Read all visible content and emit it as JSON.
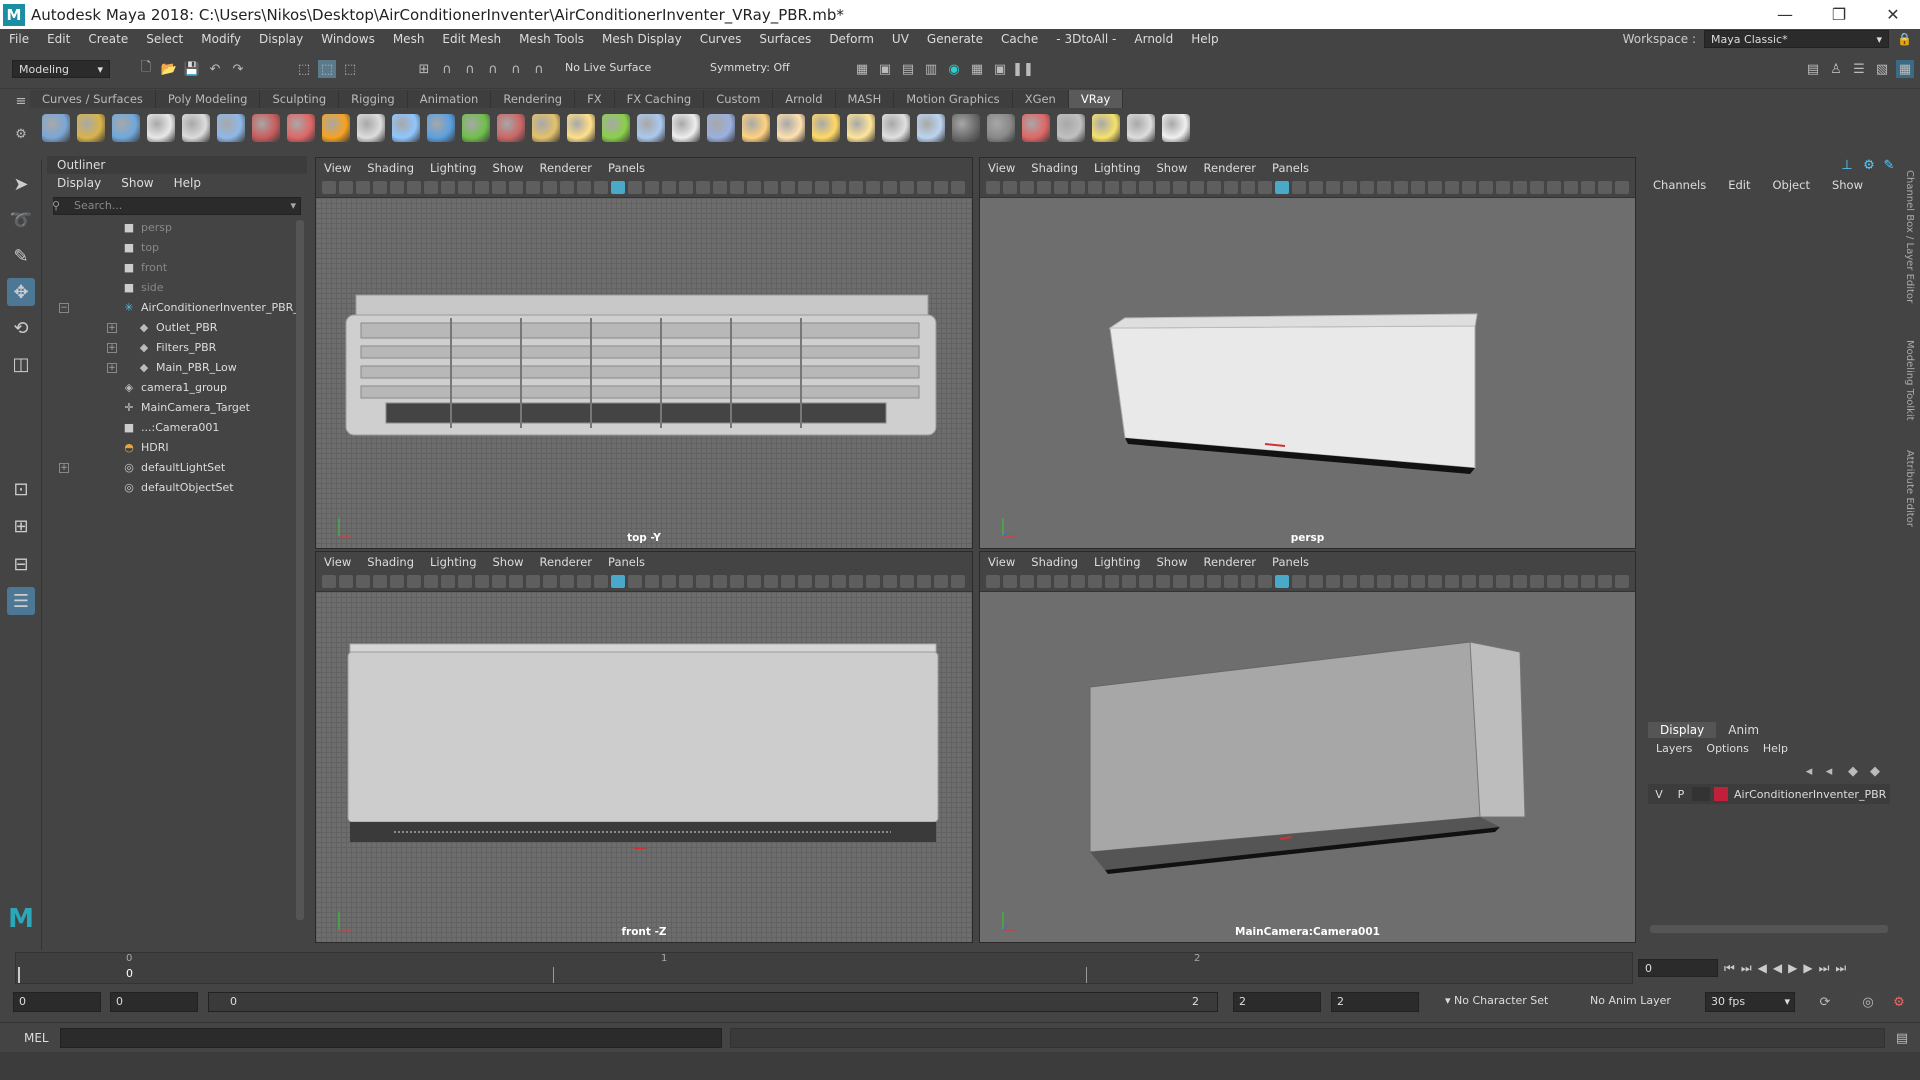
{
  "window": {
    "title": "Autodesk Maya 2018: C:\\Users\\Nikos\\Desktop\\AirConditionerInventer\\AirConditionerInventer_VRay_PBR.mb*",
    "minimize": "—",
    "maximize": "❐",
    "close": "✕"
  },
  "menubar": {
    "items": [
      "File",
      "Edit",
      "Create",
      "Select",
      "Modify",
      "Display",
      "Windows",
      "Mesh",
      "Edit Mesh",
      "Mesh Tools",
      "Mesh Display",
      "Curves",
      "Surfaces",
      "Deform",
      "UV",
      "Generate",
      "Cache",
      "- 3DtoAll -",
      "Arnold",
      "Help"
    ],
    "workspace_label": "Workspace :",
    "workspace_value": "Maya Classic*"
  },
  "statusline": {
    "mode": "Modeling",
    "live_surface": "No Live Surface",
    "symmetry": "Symmetry: Off"
  },
  "shelf": {
    "tabs": [
      "Curves / Surfaces",
      "Poly Modeling",
      "Sculpting",
      "Rigging",
      "Animation",
      "Rendering",
      "FX",
      "FX Caching",
      "Custom",
      "Arnold",
      "MASH",
      "Motion Graphics",
      "XGen",
      "VRay"
    ],
    "active_tab": "VRay",
    "icon_colors": [
      "#7aa7d6",
      "#d9b44a",
      "#6fa8dc",
      "#e8e8e8",
      "#dcdcdc",
      "#8fb8e8",
      "#c95c5c",
      "#e06666",
      "#f6a21f",
      "#dddddd",
      "#8ec6ff",
      "#5aa0e0",
      "#6fbf4a",
      "#c66",
      "#e3c26b",
      "#ffe08a",
      "#8ad04a",
      "#aac9ee",
      "#eee",
      "#9ab0e0",
      "#ffd27f",
      "#ffe0b0",
      "#ffd966",
      "#ffe599",
      "#e0e0e0",
      "#bcd4f0",
      "#6c6c6c",
      "#888",
      "#e06666",
      "#c0c0c0",
      "#f6e26b",
      "#dddddd",
      "#f0f0f0"
    ]
  },
  "outliner": {
    "title": "Outliner",
    "menu": [
      "Display",
      "Show",
      "Help"
    ],
    "search_placeholder": "Search...",
    "items": [
      {
        "label": "persp",
        "dim": true,
        "icon": "camera-icon"
      },
      {
        "label": "top",
        "dim": true,
        "icon": "camera-icon"
      },
      {
        "label": "front",
        "dim": true,
        "icon": "camera-icon"
      },
      {
        "label": "side",
        "dim": true,
        "icon": "camera-icon"
      },
      {
        "label": "AirConditionerInventer_PBR_",
        "dim": false,
        "icon": "group-icon",
        "expander": "−"
      },
      {
        "label": "Outlet_PBR",
        "dim": false,
        "icon": "mesh-icon",
        "expander": "+"
      },
      {
        "label": "Filters_PBR",
        "dim": false,
        "icon": "mesh-icon",
        "expander": "+"
      },
      {
        "label": "Main_PBR_Low",
        "dim": false,
        "icon": "mesh-icon",
        "expander": "+"
      },
      {
        "label": "camera1_group",
        "dim": false,
        "icon": "camera-group-icon"
      },
      {
        "label": "MainCamera_Target",
        "dim": false,
        "icon": "locator-icon"
      },
      {
        "label": "...:Camera001",
        "dim": false,
        "icon": "camera-icon"
      },
      {
        "label": "HDRI",
        "dim": false,
        "icon": "dome-light-icon"
      },
      {
        "label": "defaultLightSet",
        "dim": false,
        "icon": "set-icon",
        "expander": "+"
      },
      {
        "label": "defaultObjectSet",
        "dim": false,
        "icon": "set-icon"
      }
    ]
  },
  "viewports": {
    "menu": [
      "View",
      "Shading",
      "Lighting",
      "Show",
      "Renderer",
      "Panels"
    ],
    "top_left": {
      "label": "top -Y"
    },
    "top_right": {
      "label": "persp"
    },
    "bottom_left": {
      "label": "front -Z"
    },
    "bottom_right": {
      "label": "MainCamera:Camera001"
    }
  },
  "channelbox": {
    "menu": [
      "Channels",
      "Edit",
      "Object",
      "Show"
    ]
  },
  "layers": {
    "tabs": [
      "Display",
      "Anim"
    ],
    "active_tab": "Display",
    "menu": [
      "Layers",
      "Options",
      "Help"
    ],
    "row": {
      "v": "V",
      "p": "P",
      "name": "AirConditionerInventer_PBR",
      "color": "#c0203a"
    }
  },
  "side_tabs": [
    "Channel Box / Layer Editor",
    "Modeling Toolkit",
    "Attribute Editor"
  ],
  "timeslider": {
    "ticks": [
      "0",
      "1",
      "2"
    ],
    "current_frame_top": "0",
    "current_frame_field": "0"
  },
  "range": {
    "start": "0",
    "playback_start": "0",
    "slider_start": "0",
    "slider_end": "2",
    "playback_end": "2",
    "end": "2",
    "character_set": "No Character Set",
    "anim_layer": "No Anim Layer",
    "fps": "30 fps"
  },
  "cmdline": {
    "label": "MEL"
  }
}
